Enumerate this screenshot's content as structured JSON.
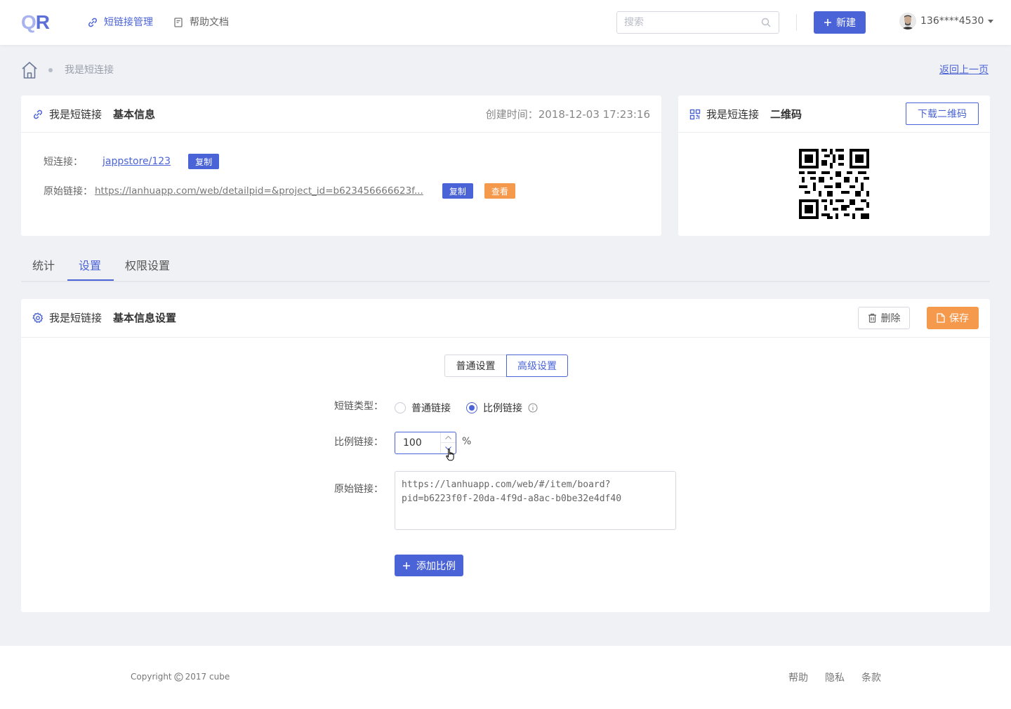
{
  "header": {
    "logo": "QR",
    "nav": [
      {
        "label": "短链接管理",
        "icon": "link-icon",
        "active": true
      },
      {
        "label": "帮助文档",
        "icon": "document-icon",
        "active": false
      }
    ],
    "search_placeholder": "搜索",
    "new_button": "新建",
    "user_phone": "136****4530",
    "accent_color": "#4a63d6"
  },
  "breadcrumb": {
    "current": "我是短连接",
    "back": "返回上一页"
  },
  "info_card": {
    "name": "我是短链接",
    "title": "基本信息",
    "created": "创建时间：2018-12-03 17:23:16",
    "short_label": "短连接：",
    "short_link": "jappstore/123",
    "copy": "复制",
    "origin_label": "原始链接：",
    "origin_link": "https://lanhuapp.com/web/detailpid=&project_id=b623456666623f...",
    "view": "查看"
  },
  "qr_card": {
    "name": "我是短连接",
    "title": "二维码",
    "download": "下载二维码"
  },
  "tabs": [
    "统计",
    "设置",
    "权限设置"
  ],
  "active_tab": 1,
  "settings": {
    "name": "我是短链接",
    "title": "基本信息设置",
    "delete": "删除",
    "save": "保存",
    "segments": [
      "普通设置",
      "高级设置"
    ],
    "active_segment": 1,
    "type_label": "短链类型：",
    "type_options": [
      "普通链接",
      "比例链接"
    ],
    "type_selected": 1,
    "ratio_label": "比例链接：",
    "ratio_value": "100",
    "ratio_unit": "%",
    "origin_label": "原始链接：",
    "origin_value": "https://lanhuapp.com/web/#/item/board?pid=b6223f0f-20da-4f9d-a8ac-b0be32e4df40",
    "add_button": "添加比例"
  },
  "footer": {
    "copyright": "Copyright",
    "copyright_rest": "2017 cube",
    "links": [
      "帮助",
      "隐私",
      "条款"
    ]
  }
}
